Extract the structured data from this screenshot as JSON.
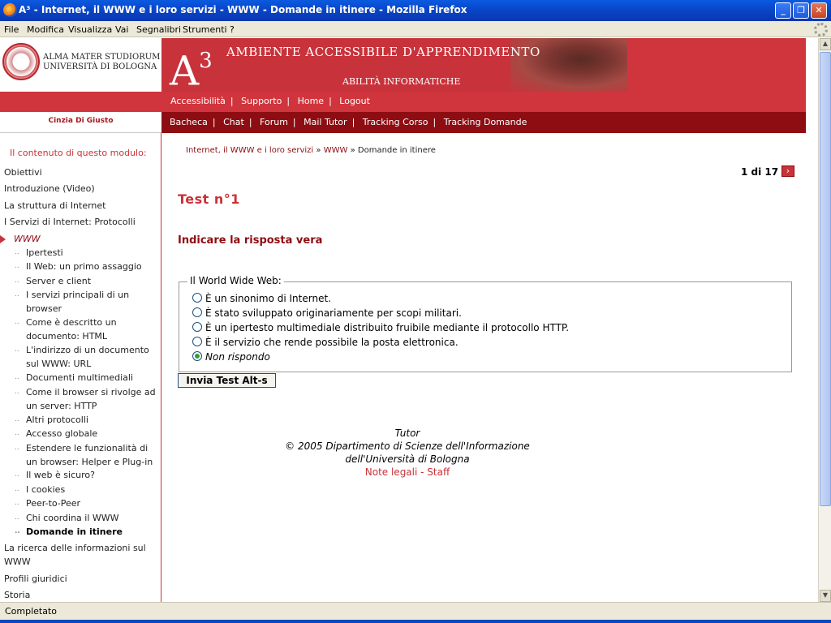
{
  "window": {
    "title": "A³ - Internet, il WWW e i loro servizi - WWW - Domande in itinere - Mozilla Firefox",
    "minimize": "_",
    "restore": "❐",
    "close": "✕"
  },
  "menubar": [
    "File",
    "Modifica",
    "Visualizza",
    "Vai",
    "Segnalibri",
    "Strumenti",
    "?"
  ],
  "header": {
    "uni_line1": "ALMA MATER STUDIORUM",
    "uni_line2": "UNIVERSITÀ DI BOLOGNA",
    "banner_a": "A",
    "banner_sup": "3",
    "banner_title": "AMBIENTE ACCESSIBILE D'APPRENDIMENTO",
    "banner_subtitle": "ABILITÀ INFORMATICHE"
  },
  "topnav": [
    "Accessibilità",
    "Supporto",
    "Home",
    "Logout"
  ],
  "user": "Cinzia Di Giusto",
  "subnav": [
    "Bacheca",
    "Chat",
    "Forum",
    "Mail Tutor",
    "Tracking Corso",
    "Tracking Domande"
  ],
  "sidebar": {
    "title": "Il contenuto di questo modulo:",
    "items": [
      "Obiettivi",
      "Introduzione (Video)",
      "La struttura di Internet",
      "I Servizi di Internet: Protocolli",
      "WWW",
      "Ipertesti",
      "Il Web: un primo assaggio",
      "Server e client",
      "I servizi principali di un browser",
      "Come è descritto un documento: HTML",
      "L'indirizzo di un documento sul WWW: URL",
      "Documenti multimediali",
      "Come il browser si rivolge ad un server: HTTP",
      "Altri protocolli",
      "Accesso globale",
      "Estendere le funzionalità di un browser: Helper e Plug-in",
      "Il web è sicuro?",
      "I cookies",
      "Peer-to-Peer",
      "Chi coordina il WWW",
      "Domande in itinere",
      "La ricerca delle informazioni sul WWW",
      "Profili giuridici",
      "Storia"
    ]
  },
  "breadcrumb": {
    "item1": "Internet, il WWW e i loro servizi",
    "sep": "»",
    "item2": "WWW",
    "item3": "Domande in itinere"
  },
  "pager": {
    "text": "1 di 17",
    "next": "›"
  },
  "test": {
    "title": "Test n°1",
    "question": "Indicare la risposta vera",
    "legend": "Il World Wide Web:",
    "options": [
      "È un sinonimo di Internet.",
      "È stato sviluppato originariamente per scopi militari.",
      "È un ipertesto multimediale distribuito fruibile mediante il protocollo HTTP.",
      "È il servizio che rende possibile la posta elettronica.",
      "Non rispondo"
    ],
    "selected_index": 4,
    "submit": "Invia Test Alt-s"
  },
  "footer": {
    "line1": "Tutor",
    "line2": "© 2005 Dipartimento di Scienze dell'Informazione",
    "line3": "dell'Università di Bologna",
    "legal": "Note legali - Staff"
  },
  "scrollbar": {
    "up": "▲",
    "down": "▼"
  },
  "status": "Completato"
}
